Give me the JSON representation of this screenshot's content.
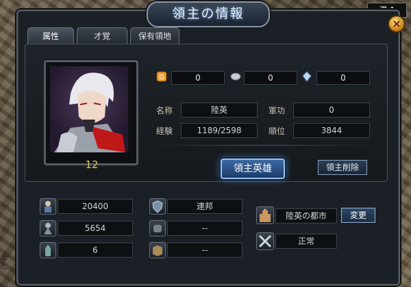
{
  "window": {
    "title": "領主の情報",
    "close_label": "×"
  },
  "corner_badge": "港 1",
  "side_text": "卑\nと",
  "tabs": [
    {
      "label": "属性",
      "active": true
    },
    {
      "label": "才覚",
      "active": false
    },
    {
      "label": "保有領地",
      "active": false
    }
  ],
  "portrait": {
    "level": "12"
  },
  "resources": [
    {
      "icon": "gold-coin-icon",
      "value": "0"
    },
    {
      "icon": "silver-coin-icon",
      "value": "0"
    },
    {
      "icon": "crystal-icon",
      "value": "0"
    }
  ],
  "info": {
    "name_label": "名称",
    "name_value": "陸英",
    "merit_label": "軍功",
    "merit_value": "0",
    "exp_label": "経験",
    "exp_value": "1189/2598",
    "rank_label": "順位",
    "rank_value": "3844"
  },
  "buttons": {
    "hero": "領主英雄",
    "delete": "領主削除",
    "change": "変更"
  },
  "stats_left": [
    {
      "icon": "soldier-icon",
      "value": "20400"
    },
    {
      "icon": "knight-icon",
      "value": "5654"
    },
    {
      "icon": "tower-icon",
      "value": "6"
    }
  ],
  "stats_middle": [
    {
      "icon": "shield-icon",
      "value": "連邦"
    },
    {
      "icon": "fist-icon",
      "value": "--"
    },
    {
      "icon": "book-icon",
      "value": "--"
    }
  ],
  "city": {
    "icon": "castle-icon",
    "value": "陸英の都市"
  },
  "status": {
    "icon": "crossed-swords-icon",
    "value": "正常"
  },
  "colors": {
    "accent": "#3b6aa2",
    "level": "#f0c650",
    "panel": "#1b2026"
  }
}
